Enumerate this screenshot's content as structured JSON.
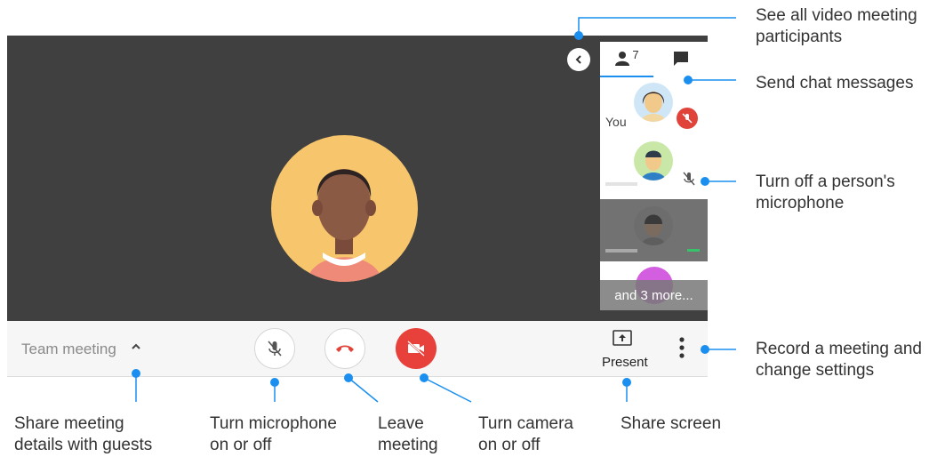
{
  "colors": {
    "stage_bg": "#404040",
    "avatar_yellow": "#f7c56b",
    "leave_red": "#e0433a",
    "camera_red": "#e8403a",
    "callout_blue": "#1a8ff0"
  },
  "toolbar": {
    "meeting_title": "Team meeting",
    "present_label": "Present",
    "mic_icon": "mic-off-icon",
    "leave_icon": "phone-hangup-icon",
    "camera_icon": "camera-off-icon",
    "present_icon": "present-screen-icon",
    "more_icon": "more-vertical-icon"
  },
  "people_panel": {
    "participant_count": "7",
    "self_label": "You",
    "overflow_label": "and 3 more..."
  },
  "callouts": {
    "see_all": "See all video meeting\nparticipants",
    "chat": "Send chat messages",
    "mute_person": "Turn off a person's\nmicrophone",
    "record": "Record a meeting and\nchange settings",
    "share_details": "Share meeting\ndetails with guests",
    "mic": "Turn microphone\non or off",
    "leave": "Leave\nmeeting",
    "camera": "Turn camera\non or off",
    "share_screen": "Share screen"
  }
}
